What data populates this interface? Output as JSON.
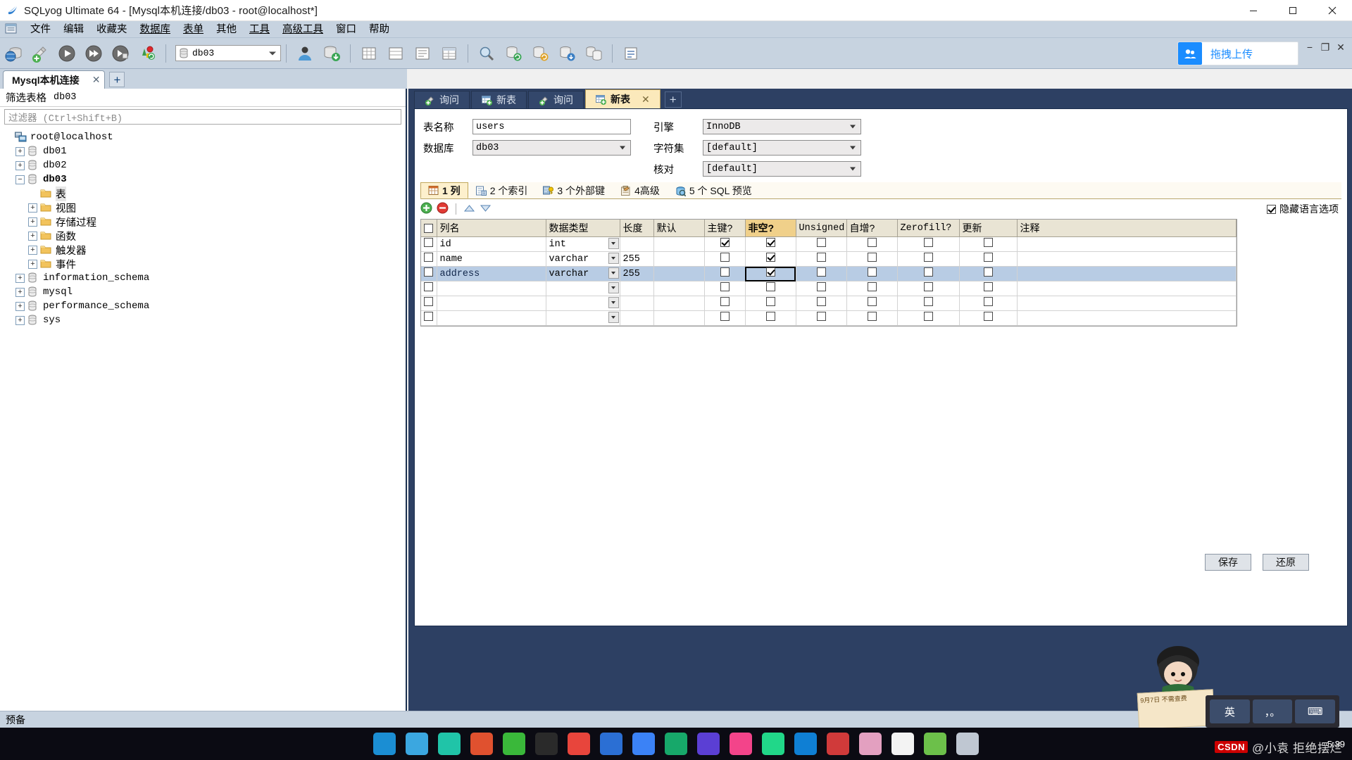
{
  "window": {
    "title": "SQLyog Ultimate 64 - [Mysql本机连接/db03 - root@localhost*]",
    "app_icon": "sqlyog-icon",
    "minimize": "−",
    "maximize": "□",
    "close": "✕"
  },
  "menu": {
    "items": [
      {
        "label": "文件",
        "name": "menu-file"
      },
      {
        "label": "编辑",
        "name": "menu-edit"
      },
      {
        "label": "收藏夹",
        "name": "menu-favorites"
      },
      {
        "label": "数据库",
        "name": "menu-database"
      },
      {
        "label": "表单",
        "name": "menu-table"
      },
      {
        "label": "其他",
        "name": "menu-others"
      },
      {
        "label": "工具",
        "name": "menu-tools"
      },
      {
        "label": "高级工具",
        "name": "menu-advanced-tools"
      },
      {
        "label": "窗口",
        "name": "menu-window"
      },
      {
        "label": "帮助",
        "name": "menu-help"
      }
    ]
  },
  "toolbar": {
    "db_selector_value": "db03",
    "upload_label": "拖拽上传",
    "mdi_minimize": "−",
    "mdi_restore": "❐",
    "mdi_close": "✕"
  },
  "connection_tabs": {
    "tabs": [
      {
        "label": "Mysql本机连接",
        "close": "✕"
      }
    ],
    "add_label": "+"
  },
  "left_panel": {
    "filter_header_label": "筛选表格",
    "filter_header_db": "db03",
    "filter_placeholder": "过滤器 (Ctrl+Shift+B)",
    "tree": [
      {
        "label": "root@localhost",
        "icon": "server-icon",
        "indent": 0,
        "expander": "",
        "bold": false,
        "cjk": false
      },
      {
        "label": "db01",
        "icon": "db-icon",
        "indent": 1,
        "expander": "+",
        "bold": false,
        "cjk": false
      },
      {
        "label": "db02",
        "icon": "db-icon",
        "indent": 1,
        "expander": "+",
        "bold": false,
        "cjk": false
      },
      {
        "label": "db03",
        "icon": "db-icon",
        "indent": 1,
        "expander": "−",
        "bold": true,
        "cjk": false
      },
      {
        "label": "表",
        "icon": "folder-icon",
        "indent": 2,
        "expander": "",
        "bold": false,
        "cjk": true,
        "selected": true
      },
      {
        "label": "视图",
        "icon": "folder-icon",
        "indent": 2,
        "expander": "+",
        "bold": false,
        "cjk": true
      },
      {
        "label": "存储过程",
        "icon": "folder-icon",
        "indent": 2,
        "expander": "+",
        "bold": false,
        "cjk": true
      },
      {
        "label": "函数",
        "icon": "folder-icon",
        "indent": 2,
        "expander": "+",
        "bold": false,
        "cjk": true
      },
      {
        "label": "触发器",
        "icon": "folder-icon",
        "indent": 2,
        "expander": "+",
        "bold": false,
        "cjk": true
      },
      {
        "label": "事件",
        "icon": "folder-icon",
        "indent": 2,
        "expander": "+",
        "bold": false,
        "cjk": true
      },
      {
        "label": "information_schema",
        "icon": "db-icon",
        "indent": 1,
        "expander": "+",
        "bold": false,
        "cjk": false
      },
      {
        "label": "mysql",
        "icon": "db-icon",
        "indent": 1,
        "expander": "+",
        "bold": false,
        "cjk": false
      },
      {
        "label": "performance_schema",
        "icon": "db-icon",
        "indent": 1,
        "expander": "+",
        "bold": false,
        "cjk": false
      },
      {
        "label": "sys",
        "icon": "db-icon",
        "indent": 1,
        "expander": "+",
        "bold": false,
        "cjk": false
      }
    ]
  },
  "document_tabs": {
    "tabs": [
      {
        "label": "询问",
        "icon": "query-icon",
        "active": false
      },
      {
        "label": "新表",
        "icon": "newtable-icon",
        "active": false
      },
      {
        "label": "询问",
        "icon": "query-icon",
        "active": false
      },
      {
        "label": "新表",
        "icon": "newtable-icon",
        "active": true,
        "close": "✕"
      }
    ],
    "add_label": "+"
  },
  "table_form": {
    "name_label": "表名称",
    "name_value": "users",
    "db_label": "数据库",
    "db_value": "db03",
    "engine_label": "引擎",
    "engine_value": "InnoDB",
    "charset_label": "字符集",
    "charset_value": "[default]",
    "collation_label": "核对",
    "collation_value": "[default]"
  },
  "inner_tabs": {
    "tabs": [
      {
        "label": "1 列",
        "icon": "columns-icon",
        "active": true
      },
      {
        "label": "2 个索引",
        "icon": "index-icon",
        "active": false
      },
      {
        "label": "3 个外部键",
        "icon": "fk-icon",
        "active": false
      },
      {
        "label": "4高级",
        "icon": "advanced-icon",
        "active": false
      },
      {
        "label": "5 个 SQL 预览",
        "icon": "sql-preview-icon",
        "active": false
      }
    ]
  },
  "grid_toolbar": {
    "add_icon": "add-row-icon",
    "remove_icon": "remove-row-icon",
    "move_up_icon": "move-up-icon",
    "move_down_icon": "move-down-icon",
    "hide_lang_label": "隐藏语言选项",
    "hide_lang_checked": true
  },
  "columns_grid": {
    "headers": [
      "",
      "列名",
      "数据类型",
      "长度",
      "默认",
      "主键?",
      "非空?",
      "Unsigned",
      "自增?",
      "Zerofill?",
      "更新",
      "注释"
    ],
    "highlighted_header_index": 6,
    "rows": [
      {
        "selected": false,
        "check": false,
        "name": "id",
        "type": "int",
        "length": "",
        "default": "",
        "pk": true,
        "notnull": true,
        "unsigned": false,
        "autoinc": false,
        "zerofill": false,
        "update": false,
        "comment": ""
      },
      {
        "selected": false,
        "check": false,
        "name": "name",
        "type": "varchar",
        "length": "255",
        "default": "",
        "pk": false,
        "notnull": true,
        "unsigned": false,
        "autoinc": false,
        "zerofill": false,
        "update": false,
        "comment": ""
      },
      {
        "selected": true,
        "check": false,
        "name": "address",
        "type": "varchar",
        "length": "255",
        "default": "",
        "pk": false,
        "notnull": true,
        "unsigned": false,
        "autoinc": false,
        "zerofill": false,
        "update": false,
        "comment": "",
        "focus_cell": "notnull"
      },
      {
        "selected": false,
        "check": false,
        "name": "",
        "type": "",
        "length": "",
        "default": "",
        "pk": false,
        "notnull": false,
        "unsigned": false,
        "autoinc": false,
        "zerofill": false,
        "update": false,
        "comment": ""
      },
      {
        "selected": false,
        "check": false,
        "name": "",
        "type": "",
        "length": "",
        "default": "",
        "pk": false,
        "notnull": false,
        "unsigned": false,
        "autoinc": false,
        "zerofill": false,
        "update": false,
        "comment": ""
      },
      {
        "selected": false,
        "check": false,
        "name": "",
        "type": "",
        "length": "",
        "default": "",
        "pk": false,
        "notnull": false,
        "unsigned": false,
        "autoinc": false,
        "zerofill": false,
        "update": false,
        "comment": ""
      }
    ]
  },
  "footer": {
    "save_label": "保存",
    "restore_label": "还原"
  },
  "statusbar": {
    "text": "预备"
  },
  "ime": {
    "lang_key": "英",
    "punct_key": "，。",
    "mode_key": "⌨"
  },
  "taskbar": {
    "apps": [
      {
        "name": "edge-icon",
        "color": "#1b8ed3"
      },
      {
        "name": "explorer-icon",
        "color": "#3ba7e0"
      },
      {
        "name": "search-icon",
        "color": "#20c4a8"
      },
      {
        "name": "record-icon",
        "color": "#e0512f"
      },
      {
        "name": "wechat-icon",
        "color": "#3ab83a"
      },
      {
        "name": "epic-icon",
        "color": "#2a2a2a"
      },
      {
        "name": "chrome-icon",
        "color": "#e8453c"
      },
      {
        "name": "app8-icon",
        "color": "#2b6fd4"
      },
      {
        "name": "thunder-icon",
        "color": "#3b82f6"
      },
      {
        "name": "globe-icon",
        "color": "#17a86a"
      },
      {
        "name": "db-app-icon",
        "color": "#5b3fd4"
      },
      {
        "name": "intellij-icon",
        "color": "#f3448a"
      },
      {
        "name": "pycharm-icon",
        "color": "#21d789"
      },
      {
        "name": "vscode-icon",
        "color": "#0f7fd4"
      },
      {
        "name": "game-icon",
        "color": "#d03a3a"
      },
      {
        "name": "anime-icon",
        "color": "#e3a0c0"
      },
      {
        "name": "sogou-icon",
        "color": "#f3f3f3"
      },
      {
        "name": "leaf-icon",
        "color": "#6cc04a"
      },
      {
        "name": "sqlyog-task-icon",
        "color": "#bfc7d2"
      }
    ],
    "tray_time": "5:39"
  },
  "watermark": {
    "brand": "CSDN",
    "author": "@小袁 拒绝摆烂"
  },
  "ad": {
    "line1": "9月7日 不需查费"
  }
}
